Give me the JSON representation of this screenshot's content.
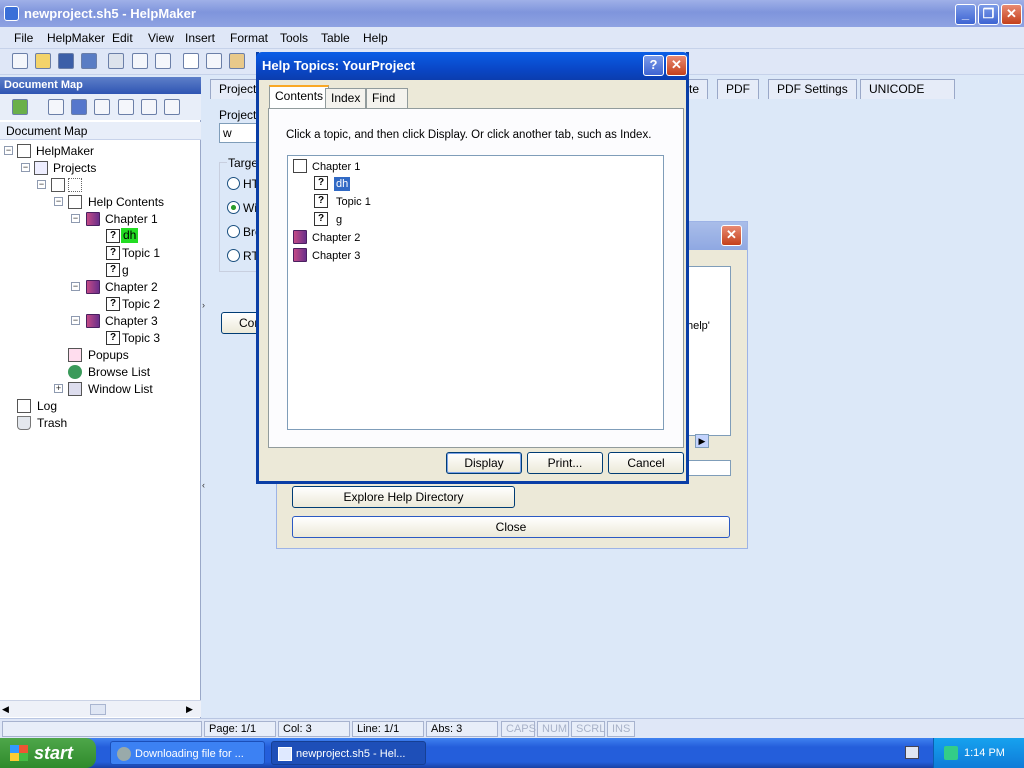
{
  "window": {
    "title": "newproject.sh5 - HelpMaker"
  },
  "menu": [
    "File",
    "HelpMaker",
    "Edit",
    "View",
    "Insert",
    "Format",
    "Tools",
    "Table",
    "Help"
  ],
  "document_map": {
    "header": "Document Map",
    "label": "Document Map",
    "tree": {
      "root": "HelpMaker",
      "projects": "Projects",
      "help_contents": "Help Contents",
      "chapter1": "Chapter 1",
      "dh": "dh",
      "topic1": "Topic 1",
      "g": "g",
      "chapter2": "Chapter 2",
      "topic2": "Topic 2",
      "chapter3": "Chapter 3",
      "topic3": "Topic 3",
      "popups": "Popups",
      "browse_list": "Browse List",
      "window_list": "Window List",
      "log": "Log",
      "trash": "Trash"
    }
  },
  "main": {
    "tabs": [
      "Project",
      "te",
      "PDF",
      "PDF Settings",
      "UNICODE"
    ],
    "project_label": "Project",
    "project_value": "w",
    "target_label": "Targe",
    "radios": [
      "HT",
      "Wi",
      "Bro",
      "RT"
    ],
    "con_button": "Con"
  },
  "back_dialog": {
    "partial_text": "help'",
    "explore_button": "Explore Help Directory",
    "close_button": "Close"
  },
  "help_dialog": {
    "title": "Help Topics: YourProject",
    "tabs": [
      "Contents",
      "Index",
      "Find"
    ],
    "instruction": "Click a topic, and then click Display. Or click another tab, such as Index.",
    "tree": {
      "chapter1": "Chapter 1",
      "dh": "dh",
      "topic1": "Topic 1",
      "g": "g",
      "chapter2": "Chapter 2",
      "chapter3": "Chapter 3"
    },
    "buttons": {
      "display": "Display",
      "print": "Print...",
      "cancel": "Cancel"
    }
  },
  "statusbar": {
    "page": "Page: 1/1",
    "col": "Col: 3",
    "line": "Line: 1/1",
    "abs": "Abs: 3",
    "caps": "CAPS",
    "num": "NUM",
    "scrl": "SCRL",
    "ins": "INS"
  },
  "taskbar": {
    "start": "start",
    "task1": "Downloading file for ...",
    "task2": "newproject.sh5 - Hel...",
    "clock": "1:14 PM"
  },
  "colors": {
    "xp_blue": "#245edb",
    "selection": "#316ac5",
    "highlight_green": "#22dd22"
  }
}
